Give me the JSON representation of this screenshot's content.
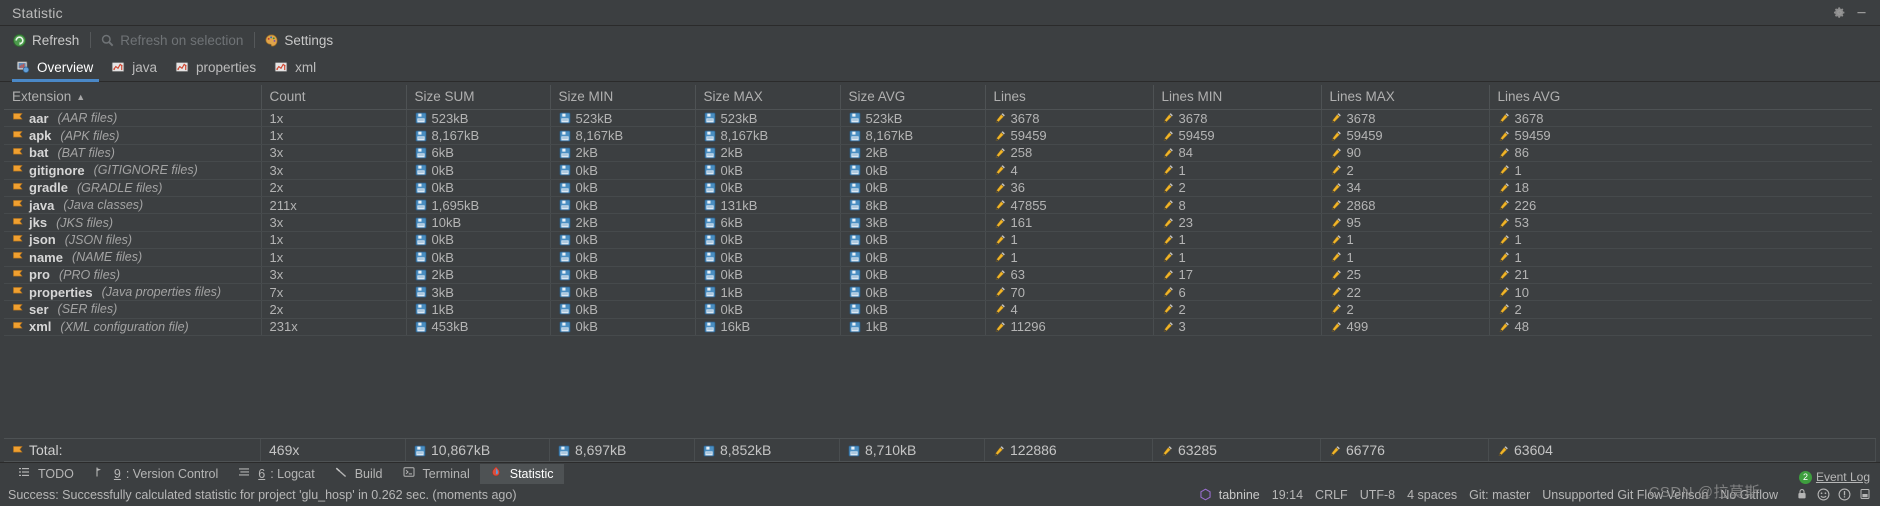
{
  "window": {
    "title": "Statistic",
    "settings_icon": "gear-icon",
    "minimize_icon": "minimize-icon"
  },
  "toolbar": {
    "refresh_label": "Refresh",
    "refresh_icon": "refresh-icon",
    "refresh_on_selection_label": "Refresh on selection",
    "refresh_on_selection_icon": "search-icon",
    "settings_label": "Settings",
    "settings_icon": "palette-icon"
  },
  "tabs": [
    {
      "label": "Overview",
      "icon": "overview-icon",
      "active": true
    },
    {
      "label": "java",
      "icon": "chart-icon",
      "active": false
    },
    {
      "label": "properties",
      "icon": "chart-icon",
      "active": false
    },
    {
      "label": "xml",
      "icon": "chart-icon",
      "active": false
    }
  ],
  "table": {
    "sort_column": "Extension",
    "sort_direction": "ascending",
    "columns": [
      "Extension",
      "Count",
      "Size SUM",
      "Size MIN",
      "Size MAX",
      "Size AVG",
      "Lines",
      "Lines MIN",
      "Lines MAX",
      "Lines AVG"
    ],
    "rows": [
      {
        "ext": "aar",
        "desc": "(AAR files)",
        "count": "1x",
        "size_sum": "523kB",
        "size_min": "523kB",
        "size_max": "523kB",
        "size_avg": "523kB",
        "lines": "3678",
        "lines_min": "3678",
        "lines_max": "3678",
        "lines_avg": "3678"
      },
      {
        "ext": "apk",
        "desc": "(APK files)",
        "count": "1x",
        "size_sum": "8,167kB",
        "size_min": "8,167kB",
        "size_max": "8,167kB",
        "size_avg": "8,167kB",
        "lines": "59459",
        "lines_min": "59459",
        "lines_max": "59459",
        "lines_avg": "59459"
      },
      {
        "ext": "bat",
        "desc": "(BAT files)",
        "count": "3x",
        "size_sum": "6kB",
        "size_min": "2kB",
        "size_max": "2kB",
        "size_avg": "2kB",
        "lines": "258",
        "lines_min": "84",
        "lines_max": "90",
        "lines_avg": "86"
      },
      {
        "ext": "gitignore",
        "desc": "(GITIGNORE files)",
        "count": "3x",
        "size_sum": "0kB",
        "size_min": "0kB",
        "size_max": "0kB",
        "size_avg": "0kB",
        "lines": "4",
        "lines_min": "1",
        "lines_max": "2",
        "lines_avg": "1"
      },
      {
        "ext": "gradle",
        "desc": "(GRADLE files)",
        "count": "2x",
        "size_sum": "0kB",
        "size_min": "0kB",
        "size_max": "0kB",
        "size_avg": "0kB",
        "lines": "36",
        "lines_min": "2",
        "lines_max": "34",
        "lines_avg": "18"
      },
      {
        "ext": "java",
        "desc": "(Java classes)",
        "count": "211x",
        "size_sum": "1,695kB",
        "size_min": "0kB",
        "size_max": "131kB",
        "size_avg": "8kB",
        "lines": "47855",
        "lines_min": "8",
        "lines_max": "2868",
        "lines_avg": "226"
      },
      {
        "ext": "jks",
        "desc": "(JKS files)",
        "count": "3x",
        "size_sum": "10kB",
        "size_min": "2kB",
        "size_max": "6kB",
        "size_avg": "3kB",
        "lines": "161",
        "lines_min": "23",
        "lines_max": "95",
        "lines_avg": "53"
      },
      {
        "ext": "json",
        "desc": "(JSON files)",
        "count": "1x",
        "size_sum": "0kB",
        "size_min": "0kB",
        "size_max": "0kB",
        "size_avg": "0kB",
        "lines": "1",
        "lines_min": "1",
        "lines_max": "1",
        "lines_avg": "1"
      },
      {
        "ext": "name",
        "desc": "(NAME files)",
        "count": "1x",
        "size_sum": "0kB",
        "size_min": "0kB",
        "size_max": "0kB",
        "size_avg": "0kB",
        "lines": "1",
        "lines_min": "1",
        "lines_max": "1",
        "lines_avg": "1"
      },
      {
        "ext": "pro",
        "desc": "(PRO files)",
        "count": "3x",
        "size_sum": "2kB",
        "size_min": "0kB",
        "size_max": "0kB",
        "size_avg": "0kB",
        "lines": "63",
        "lines_min": "17",
        "lines_max": "25",
        "lines_avg": "21"
      },
      {
        "ext": "properties",
        "desc": "(Java properties files)",
        "count": "7x",
        "size_sum": "3kB",
        "size_min": "0kB",
        "size_max": "1kB",
        "size_avg": "0kB",
        "lines": "70",
        "lines_min": "6",
        "lines_max": "22",
        "lines_avg": "10"
      },
      {
        "ext": "ser",
        "desc": "(SER files)",
        "count": "2x",
        "size_sum": "1kB",
        "size_min": "0kB",
        "size_max": "0kB",
        "size_avg": "0kB",
        "lines": "4",
        "lines_min": "2",
        "lines_max": "2",
        "lines_avg": "2"
      },
      {
        "ext": "xml",
        "desc": "(XML configuration file)",
        "count": "231x",
        "size_sum": "453kB",
        "size_min": "0kB",
        "size_max": "16kB",
        "size_avg": "1kB",
        "lines": "11296",
        "lines_min": "3",
        "lines_max": "499",
        "lines_avg": "48"
      }
    ],
    "total": {
      "label": "Total:",
      "count": "469x",
      "size_sum": "10,867kB",
      "size_min": "8,697kB",
      "size_max": "8,852kB",
      "size_avg": "8,710kB",
      "lines": "122886",
      "lines_min": "63285",
      "lines_max": "66776",
      "lines_avg": "63604"
    }
  },
  "bottom_bar": {
    "items": [
      {
        "label": "TODO",
        "icon": "list-icon",
        "shortcut": "",
        "active": false
      },
      {
        "label": ": Version Control",
        "icon": "branch-icon",
        "shortcut": "9",
        "active": false
      },
      {
        "label": ": Logcat",
        "icon": "lines-icon",
        "shortcut": "6",
        "active": false
      },
      {
        "label": "Build",
        "icon": "hammer-icon",
        "shortcut": "",
        "active": false
      },
      {
        "label": "Terminal",
        "icon": "terminal-icon",
        "shortcut": "",
        "active": false
      },
      {
        "label": "Statistic",
        "icon": "statistic-icon",
        "shortcut": "",
        "active": true
      }
    ]
  },
  "status_bar": {
    "message": "Success: Successfully calculated statistic for project 'glu_hosp' in 0.262 sec. (moments ago)",
    "tabnine": "tabnine",
    "time": "19:14",
    "line_separator": "CRLF",
    "encoding": "UTF-8",
    "indent": "4 spaces",
    "git_branch": "Git: master",
    "git_flow_version": "Unsupported Git Flow Verison",
    "gitflow": "No Gitflow",
    "event_log_label": "Event Log",
    "event_log_count": "2",
    "watermark": "CSDN @拉莫斯"
  },
  "colors": {
    "background": "#3c3f41",
    "accent": "#4a88c7",
    "flag": "#f0a030",
    "floppy": "#3d7fb8",
    "pencil": "#e8b020",
    "text": "#b4b4b4"
  }
}
